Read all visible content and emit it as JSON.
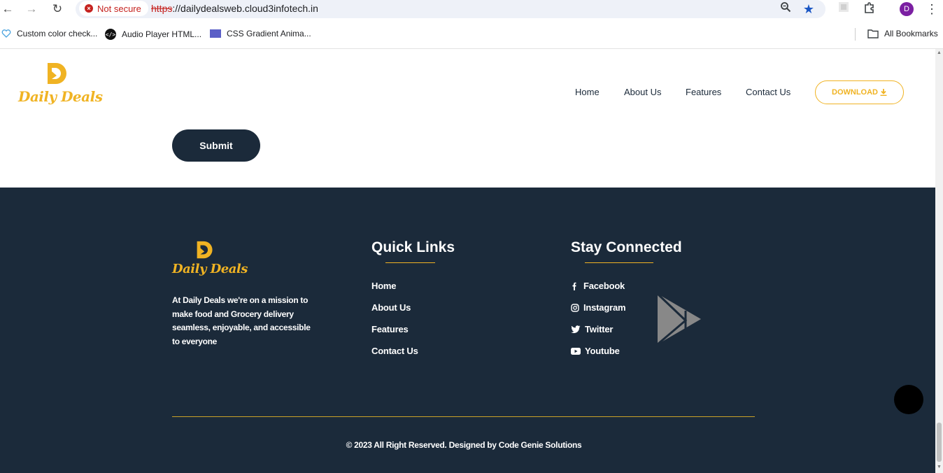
{
  "browser": {
    "security_label": "Not secure",
    "url_scheme": "https",
    "url_rest": "://dailydealsweb.cloud3infotech.in",
    "avatar_initial": "D",
    "bookmarks": [
      {
        "label": "Custom color check...",
        "icon": "heart-icon"
      },
      {
        "label": "Audio Player HTML...",
        "icon": "code-icon"
      },
      {
        "label": "CSS Gradient Anima...",
        "icon": "gradient-icon"
      }
    ],
    "all_bookmarks_label": "All Bookmarks"
  },
  "header": {
    "logo_text": "Daily Deals",
    "nav": [
      "Home",
      "About Us",
      "Features",
      "Contact Us"
    ],
    "download_label": "DOWNLOAD"
  },
  "form": {
    "submit_label": "Submit"
  },
  "footer": {
    "logo_text": "Daily Deals",
    "about_text": "At Daily Deals we're on a mission to make food and Grocery delivery seamless, enjoyable, and accessible to everyone",
    "quick_links_title": "Quick Links",
    "quick_links": [
      "Home",
      "About Us",
      "Features",
      "Contact Us"
    ],
    "stay_connected_title": "Stay Connected",
    "social": [
      {
        "label": "Facebook",
        "icon": "facebook-icon"
      },
      {
        "label": "Instagram",
        "icon": "instagram-icon"
      },
      {
        "label": "Twitter",
        "icon": "twitter-icon"
      },
      {
        "label": "Youtube",
        "icon": "youtube-icon"
      }
    ],
    "copyright_prefix": "© 2023 All Right Reserved. Designed by",
    "copyright_company": "Code Genie Solutions"
  },
  "colors": {
    "accent": "#f0b323",
    "footer_bg": "#1b2a3a",
    "submit_bg": "#1b2a3a"
  }
}
